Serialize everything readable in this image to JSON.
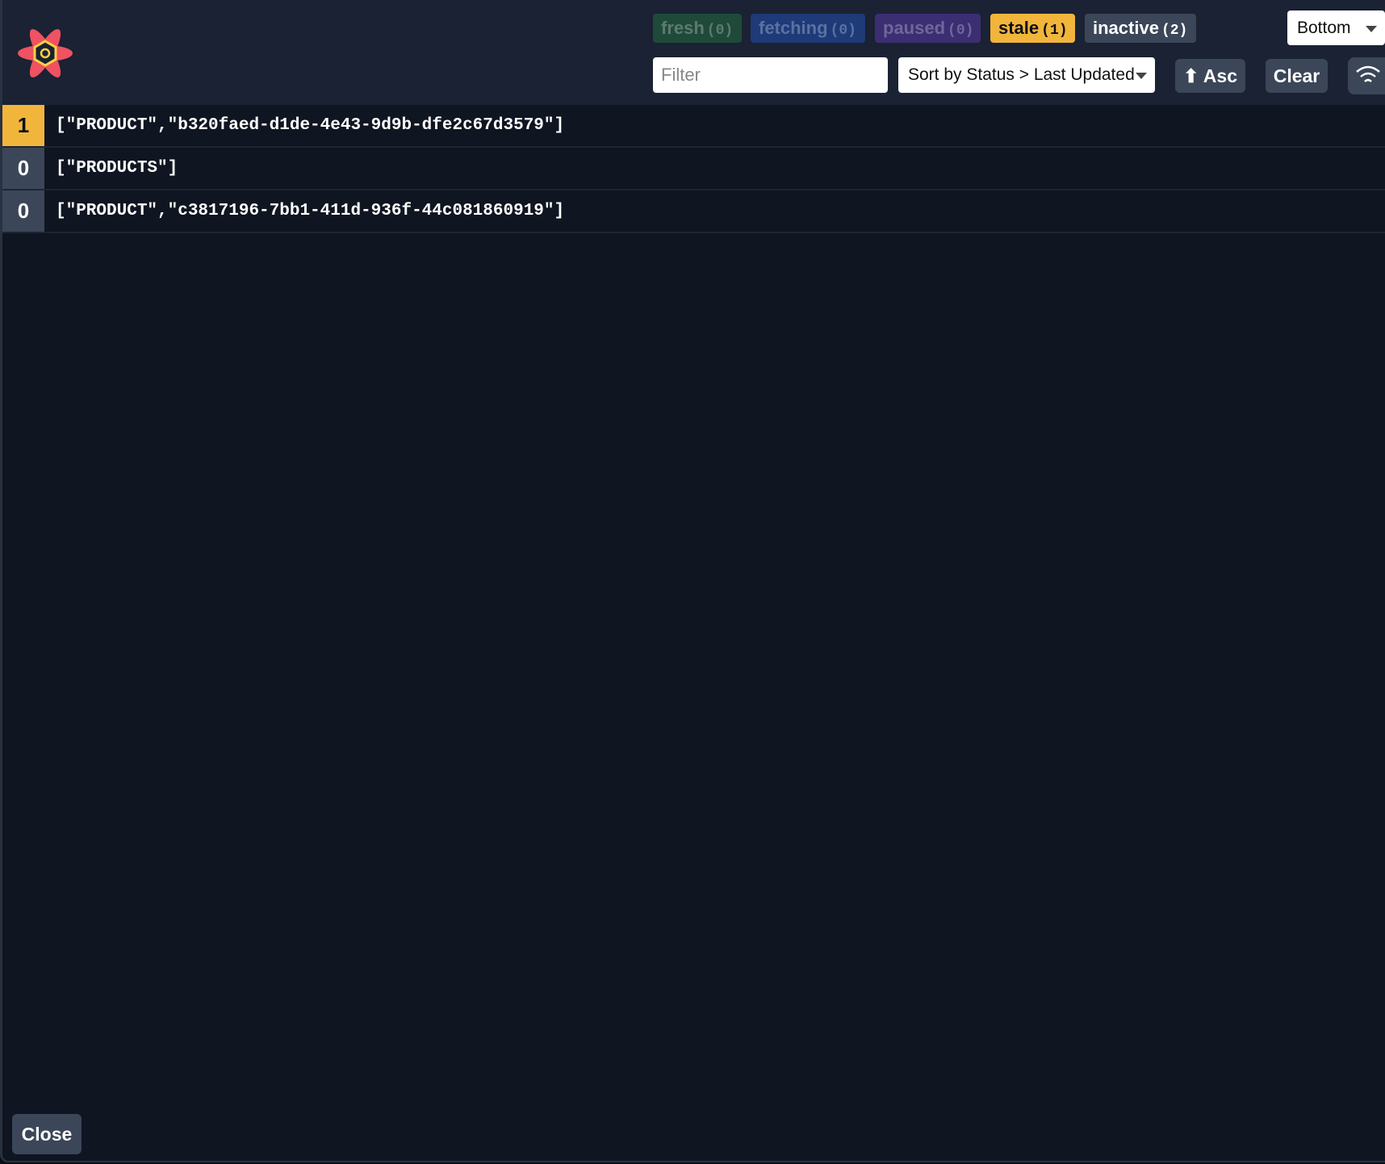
{
  "header": {
    "logo": "react-query-logo",
    "badges": [
      {
        "label": "fresh",
        "count": "(0)"
      },
      {
        "label": "fetching",
        "count": "(0)"
      },
      {
        "label": "paused",
        "count": "(0)"
      },
      {
        "label": "stale",
        "count": "(1)"
      },
      {
        "label": "inactive",
        "count": "(2)"
      }
    ],
    "position_select": "Bottom",
    "filter_placeholder": "Filter",
    "sort_select": "Sort by Status > Last Updated",
    "asc_label": "⬆ Asc",
    "clear_label": "Clear",
    "network_icon": "wifi-icon"
  },
  "queries": [
    {
      "count": "1",
      "status": "stale",
      "key": "[\"PRODUCT\",\"b320faed-d1de-4e43-9d9b-dfe2c67d3579\"]"
    },
    {
      "count": "0",
      "status": "inactive",
      "key": "[\"PRODUCTS\"]"
    },
    {
      "count": "0",
      "status": "inactive",
      "key": "[\"PRODUCT\",\"c3817196-7bb1-411d-936f-44c081860919\"]"
    }
  ],
  "close_label": "Close",
  "colors": {
    "fresh": "#1f4a3a",
    "fetching": "#1e3a78",
    "paused": "#3b2e72",
    "stale": "#f2b53c",
    "inactive": "#3b4658",
    "background": "#0f1521"
  }
}
